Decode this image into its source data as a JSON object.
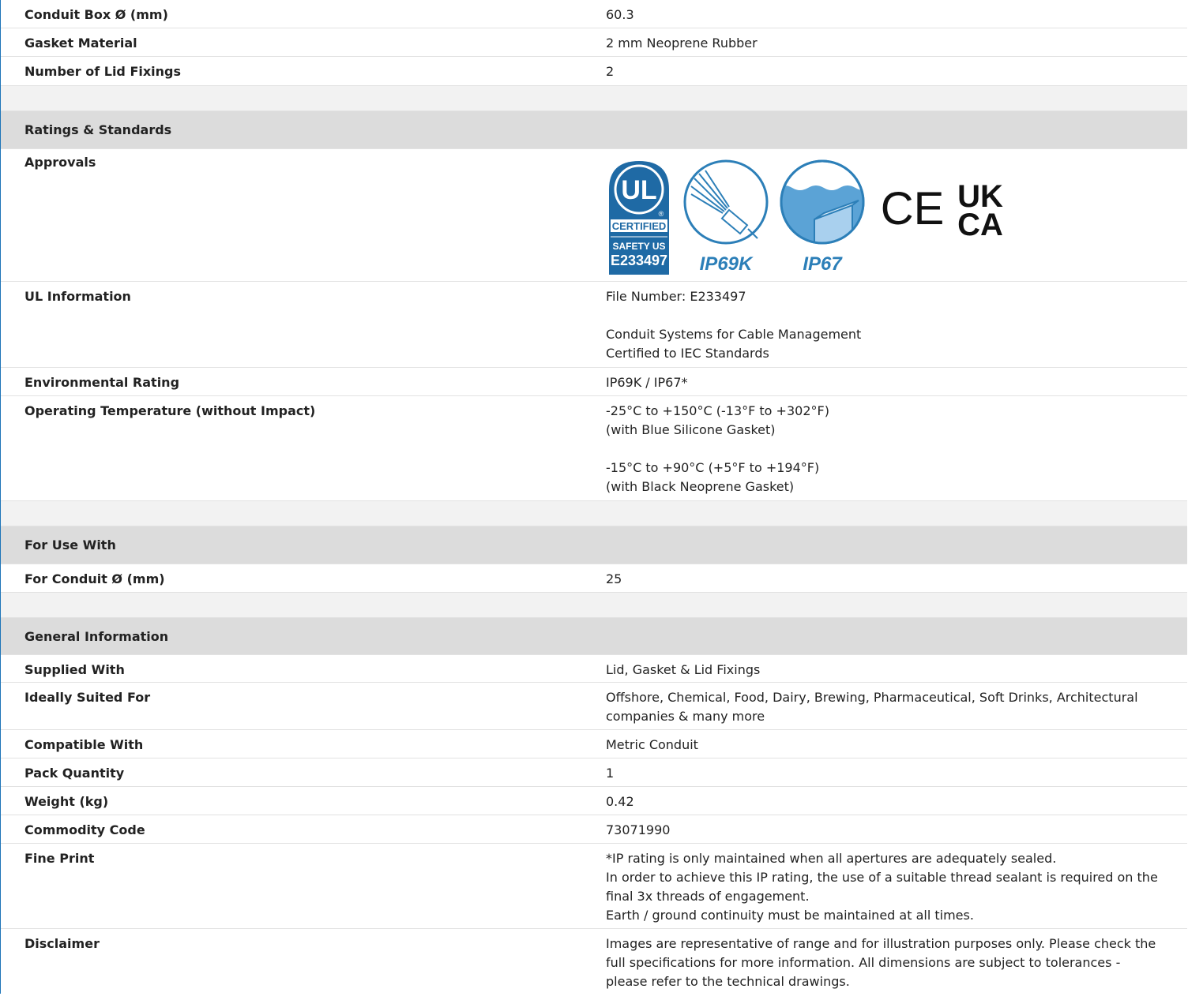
{
  "rows_top": [
    {
      "label": "Conduit Box Ø (mm)",
      "value": [
        "60.3"
      ]
    },
    {
      "label": "Gasket Material",
      "value": [
        "2 mm Neoprene Rubber"
      ]
    },
    {
      "label": "Number of Lid Fixings",
      "value": [
        "2"
      ]
    }
  ],
  "ratings": {
    "title": "Ratings & Standards",
    "approvals_label": "Approvals",
    "logos": {
      "ul_top": "UL",
      "ul_certified": "CERTIFIED",
      "ul_safety": "SAFETY US",
      "ul_number": "E233497",
      "ip69k": "IP69K",
      "ip67": "IP67",
      "ce": "CE",
      "ukca_top": "UK",
      "ukca_bottom": "CA"
    },
    "rows": [
      {
        "label": "UL Information",
        "value": [
          "File Number: E233497",
          "",
          "Conduit Systems for Cable Management",
          "Certified to IEC Standards"
        ]
      },
      {
        "label": "Environmental Rating",
        "value": [
          "IP69K / IP67*"
        ]
      },
      {
        "label": "Operating Temperature (without Impact)",
        "value": [
          "-25°C to +150°C (-13°F to +302°F)",
          "(with Blue Silicone Gasket)",
          "",
          "-15°C to +90°C (+5°F to +194°F)",
          "(with Black Neoprene Gasket)"
        ]
      }
    ]
  },
  "use_with": {
    "title": "For Use With",
    "rows": [
      {
        "label": "For Conduit Ø (mm)",
        "value": [
          "25"
        ]
      }
    ]
  },
  "general": {
    "title": "General Information",
    "rows": [
      {
        "label": "Supplied With",
        "value": [
          "Lid, Gasket & Lid Fixings"
        ]
      },
      {
        "label": "Ideally Suited For",
        "value": [
          "Offshore, Chemical, Food, Dairy, Brewing, Pharmaceutical, Soft Drinks, Architectural",
          "companies & many more"
        ]
      },
      {
        "label": "Compatible With",
        "value": [
          "Metric Conduit"
        ]
      },
      {
        "label": "Pack Quantity",
        "value": [
          "1"
        ]
      },
      {
        "label": "Weight (kg)",
        "value": [
          "0.42"
        ]
      },
      {
        "label": "Commodity Code",
        "value": [
          "73071990"
        ]
      },
      {
        "label": "Fine Print",
        "value": [
          "*IP rating is only maintained when all apertures are adequately sealed.",
          "In order to achieve this IP rating, the use of a suitable thread sealant is required on the",
          "final 3x threads of engagement.",
          "Earth / ground continuity must be maintained at all times."
        ]
      },
      {
        "label": "Disclaimer",
        "value": [
          "Images are representative of range and for illustration purposes only. Please check the",
          "full specifications for more information. All dimensions are subject to tolerances -",
          "please refer to the technical drawings."
        ]
      }
    ]
  },
  "colors": {
    "section_bg": "#dcdcdc",
    "gap_bg": "#f2f2f2",
    "ul_blue": "#1f6aa5",
    "ip_blue": "#2c7fb8"
  }
}
